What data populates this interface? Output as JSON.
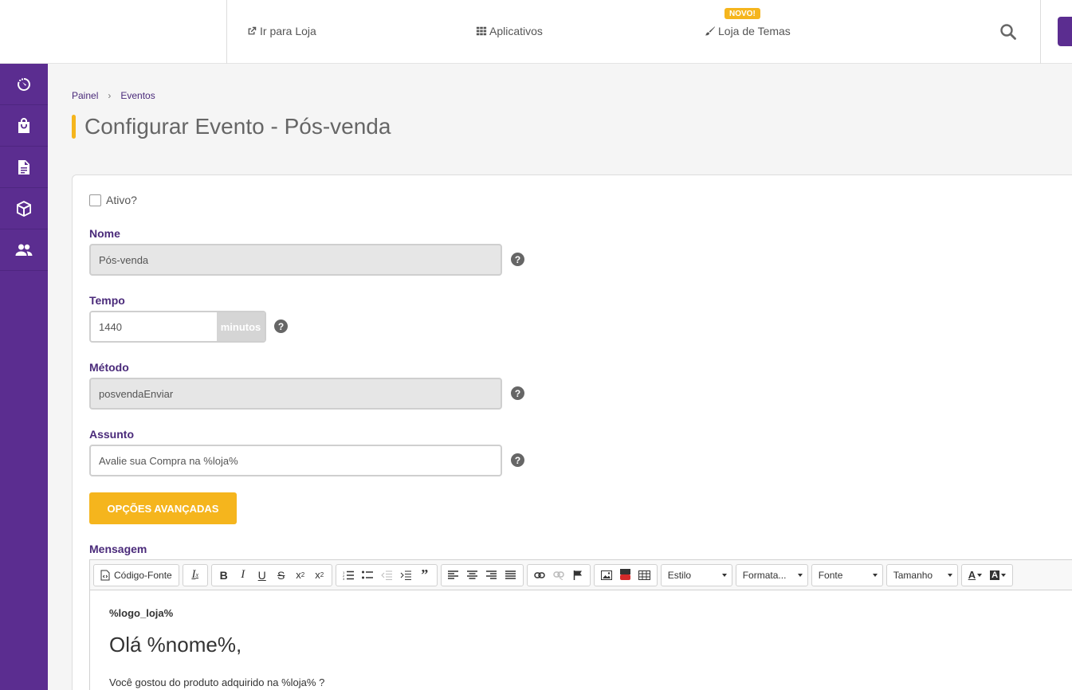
{
  "topbar": {
    "ir_para_loja": "Ir para Loja",
    "aplicativos": "Aplicativos",
    "loja_temas": "Loja de Temas",
    "badge": "NOVO!"
  },
  "sidebar": {
    "items": [
      "dashboard-icon",
      "shopping-bag-icon",
      "document-icon",
      "box-icon",
      "users-icon"
    ]
  },
  "breadcrumb": {
    "root": "Painel",
    "sep": "›",
    "current": "Eventos"
  },
  "page_title": "Configurar Evento - Pós-venda",
  "form": {
    "ativo_label": "Ativo?",
    "nome_label": "Nome",
    "nome_value": "Pós-venda",
    "tempo_label": "Tempo",
    "tempo_value": "1440",
    "tempo_unit": "minutos",
    "metodo_label": "Método",
    "metodo_value": "posvendaEnviar",
    "assunto_label": "Assunto",
    "assunto_value": "Avalie sua Compra na %loja%",
    "advanced_button": "OPÇÕES AVANÇADAS",
    "mensagem_label": "Mensagem",
    "help": "?"
  },
  "editor": {
    "source_label": "Código-Fonte",
    "estilo": "Estilo",
    "formatacao": "Formata...",
    "fonte": "Fonte",
    "tamanho": "Tamanho",
    "content": {
      "logo": "%logo_loja%",
      "greeting": "Olá %nome%,",
      "paragraph": "Você gostou do produto adquirido na %loja% ?"
    }
  }
}
